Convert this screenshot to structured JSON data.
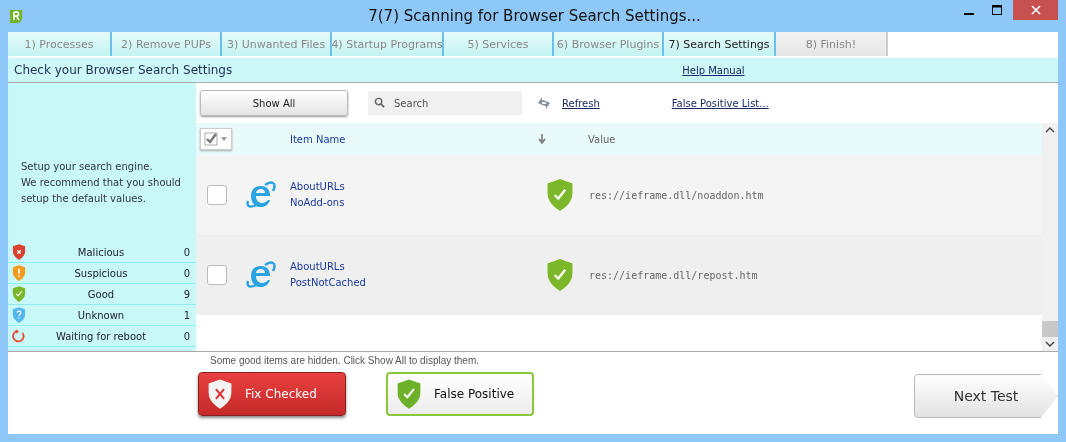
{
  "window": {
    "title": "7(7) Scanning for Browser Search Settings..."
  },
  "steps": [
    {
      "label": "1) Processes",
      "done": true,
      "selected": false
    },
    {
      "label": "2) Remove PUPs",
      "done": true,
      "selected": false
    },
    {
      "label": "3) Unwanted Files",
      "done": true,
      "selected": false
    },
    {
      "label": "4) Startup Programs",
      "done": true,
      "selected": false
    },
    {
      "label": "5) Services",
      "done": true,
      "selected": false
    },
    {
      "label": "6) Browser Plugins",
      "done": true,
      "selected": false
    },
    {
      "label": "7) Search Settings",
      "done": false,
      "selected": true
    },
    {
      "label": "8) Finish!",
      "done": false,
      "selected": false
    }
  ],
  "header": {
    "title": "Check your Browser Search Settings",
    "help_link": "Help Manual"
  },
  "sidebar": {
    "description": [
      "Setup your search engine.",
      "We recommend that you should",
      "setup the default values."
    ],
    "legend": [
      {
        "kind": "malicious",
        "label": "Malicious",
        "count": "0"
      },
      {
        "kind": "suspicious",
        "label": "Suspicious",
        "count": "0"
      },
      {
        "kind": "good",
        "label": "Good",
        "count": "9"
      },
      {
        "kind": "unknown",
        "label": "Unknown",
        "count": "1"
      },
      {
        "kind": "reboot",
        "label": "Waiting for reboot",
        "count": "0"
      }
    ]
  },
  "toolbar": {
    "show_all": "Show All",
    "search": {
      "placeholder": "Search"
    },
    "refresh": "Refresh",
    "false_positive_list": "False Positive List..."
  },
  "table": {
    "select_all_checked": true,
    "columns": [
      "Item Name",
      "Value"
    ],
    "rows": [
      {
        "checked": false,
        "name": [
          "AboutURLs",
          "NoAdd-ons"
        ],
        "kind": "good",
        "value": "res://ieframe.dll/noaddon.htm"
      },
      {
        "checked": false,
        "name": [
          "AboutURLs",
          "PostNotCached"
        ],
        "kind": "good",
        "value": "res://ieframe.dll/repost.htm"
      }
    ]
  },
  "note": "Some good items are hidden. Click Show All to display them.",
  "buttons": {
    "fix": "Fix Checked",
    "false_positive": "False Positive",
    "next": "Next Test"
  }
}
